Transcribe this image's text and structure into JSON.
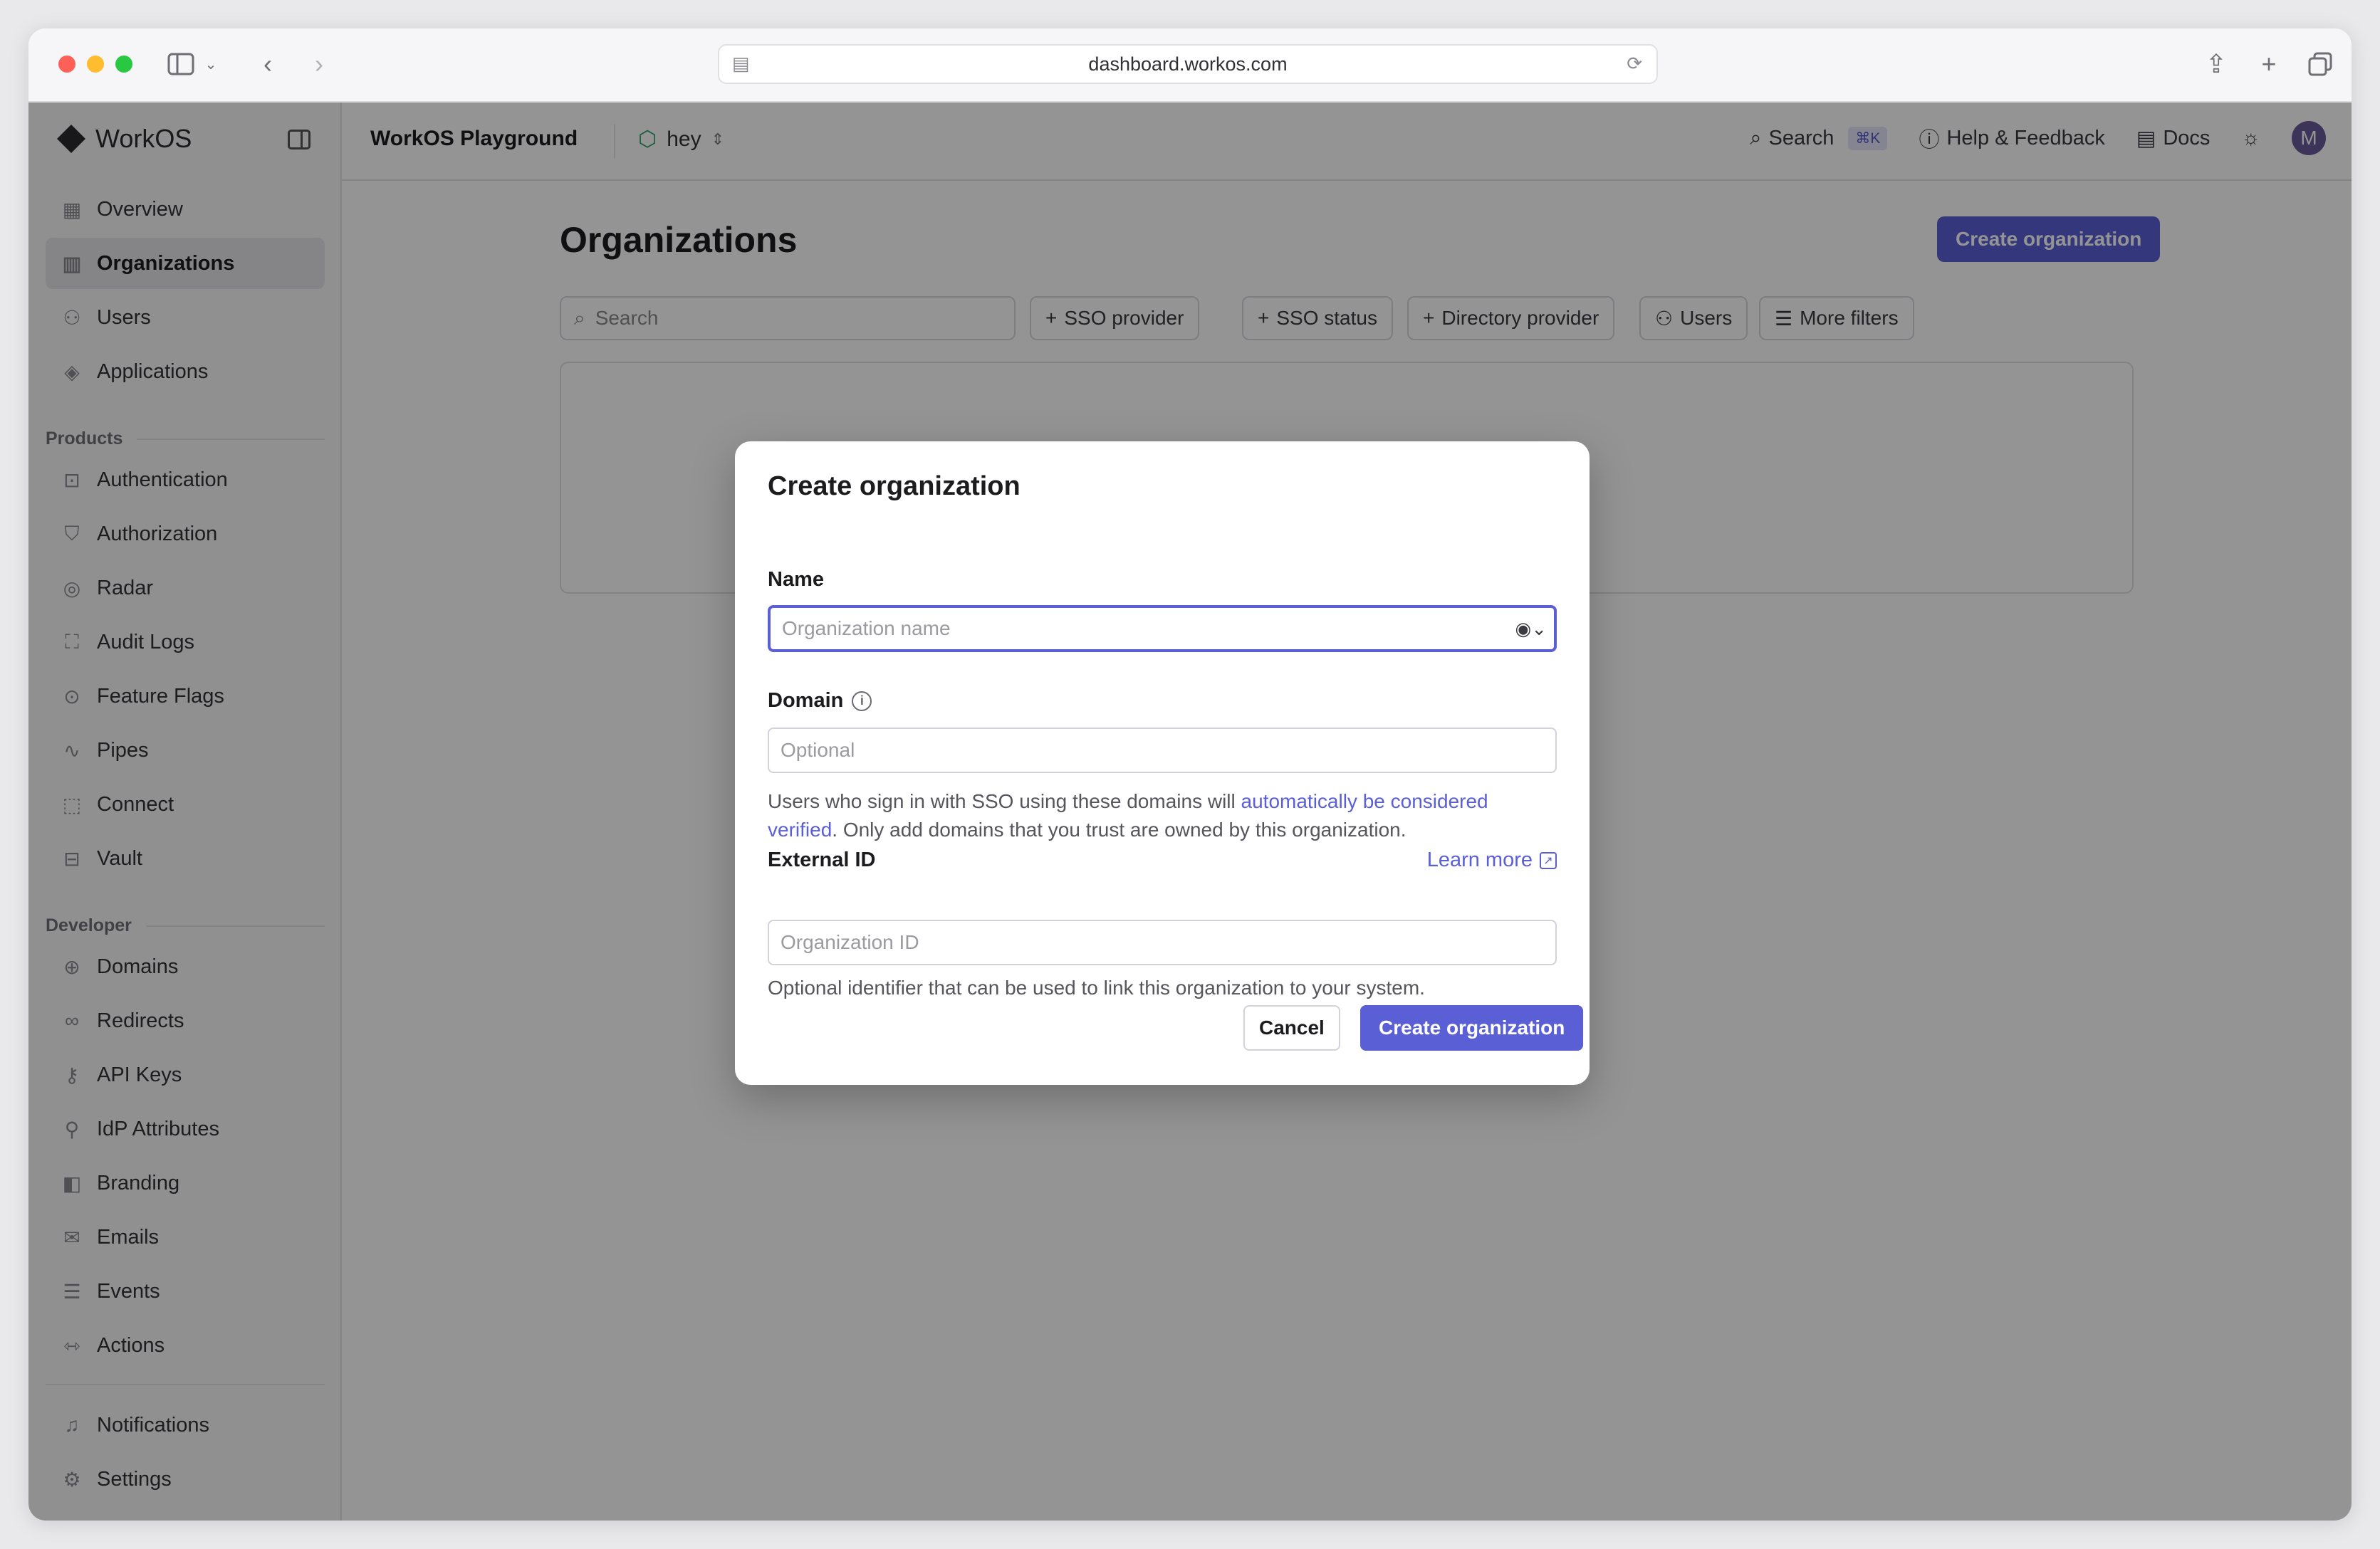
{
  "browser": {
    "url": "dashboard.workos.com"
  },
  "sidebar": {
    "brand": "WorkOS",
    "top_items": [
      {
        "label": "Overview",
        "icon": "grid-icon"
      },
      {
        "label": "Organizations",
        "icon": "building-icon",
        "active": true
      },
      {
        "label": "Users",
        "icon": "user-icon"
      },
      {
        "label": "Applications",
        "icon": "layers-icon"
      }
    ],
    "products_label": "Products",
    "product_items": [
      {
        "label": "Authentication",
        "icon": "key-box-icon"
      },
      {
        "label": "Authorization",
        "icon": "shield-icon"
      },
      {
        "label": "Radar",
        "icon": "radar-icon"
      },
      {
        "label": "Audit Logs",
        "icon": "audit-icon"
      },
      {
        "label": "Feature Flags",
        "icon": "toggle-icon"
      },
      {
        "label": "Pipes",
        "icon": "pipes-icon"
      },
      {
        "label": "Connect",
        "icon": "connect-icon"
      },
      {
        "label": "Vault",
        "icon": "vault-icon"
      }
    ],
    "developer_label": "Developer",
    "developer_items": [
      {
        "label": "Domains",
        "icon": "globe-icon"
      },
      {
        "label": "Redirects",
        "icon": "link-icon"
      },
      {
        "label": "API Keys",
        "icon": "key-icon"
      },
      {
        "label": "IdP Attributes",
        "icon": "attributes-icon"
      },
      {
        "label": "Branding",
        "icon": "brush-icon"
      },
      {
        "label": "Emails",
        "icon": "mail-icon"
      },
      {
        "label": "Events",
        "icon": "events-icon"
      },
      {
        "label": "Actions",
        "icon": "actions-icon"
      }
    ],
    "bottom_items": [
      {
        "label": "Notifications",
        "icon": "bell-icon"
      },
      {
        "label": "Settings",
        "icon": "gear-icon"
      }
    ]
  },
  "topbar": {
    "workspace": "WorkOS Playground",
    "environment": "hey",
    "search_label": "Search",
    "search_shortcut": "⌘K",
    "help_label": "Help & Feedback",
    "docs_label": "Docs",
    "avatar_initial": "M"
  },
  "page": {
    "title": "Organizations",
    "create_button": "Create organization",
    "search_placeholder": "Search",
    "filters": [
      "SSO provider",
      "SSO status",
      "Directory provider",
      "Users",
      "More filters"
    ]
  },
  "modal": {
    "title": "Create organization",
    "name_label": "Name",
    "name_placeholder": "Organization name",
    "domain_label": "Domain",
    "domain_placeholder": "Optional",
    "domain_help_pre": "Users who sign in with SSO using these domains will ",
    "domain_help_link": "automatically be considered verified",
    "domain_help_post": ". Only add domains that you trust are owned by this organization.",
    "external_id_label": "External ID",
    "learn_more": "Learn more",
    "external_id_placeholder": "Organization ID",
    "external_id_help": "Optional identifier that can be used to link this organization to your system.",
    "cancel_label": "Cancel",
    "create_label": "Create organization"
  },
  "colors": {
    "accent": "#5b5fd6",
    "env_icon": "#2f9e6a"
  }
}
